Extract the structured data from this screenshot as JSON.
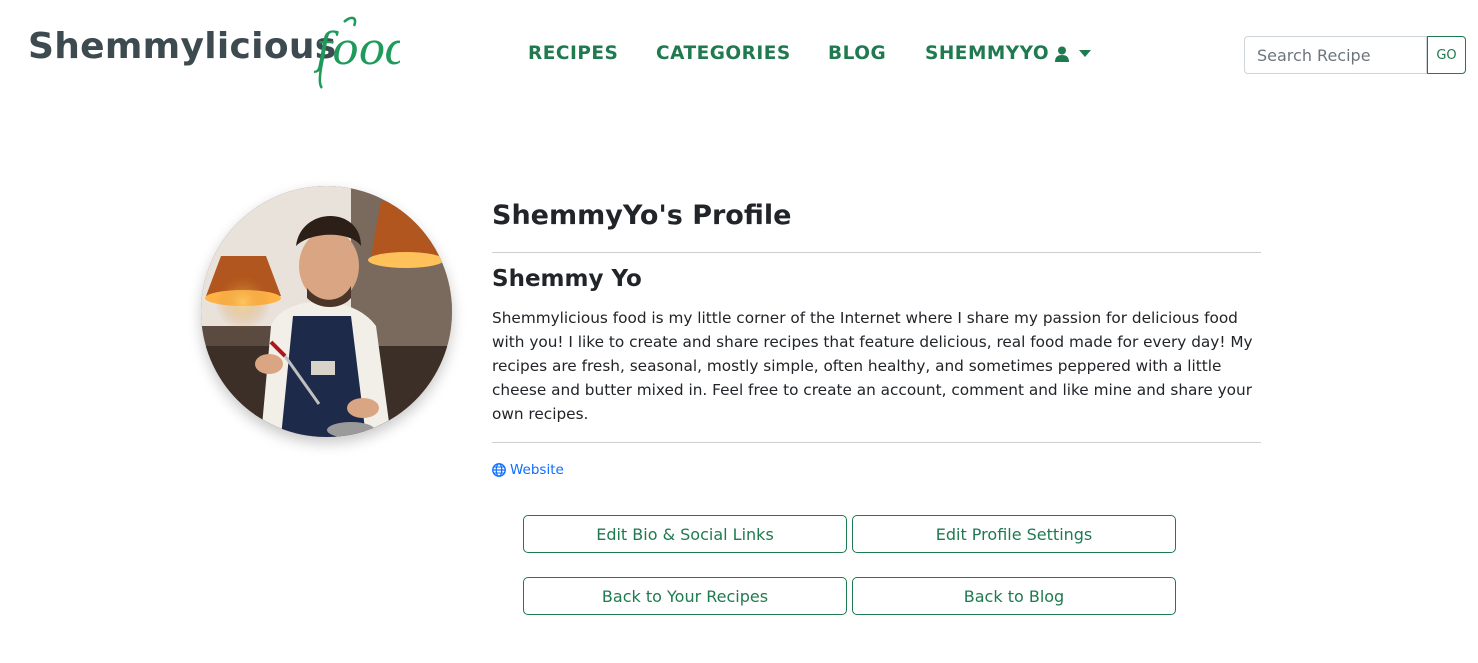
{
  "brand": {
    "name": "Shemmylicious",
    "script": "food",
    "main_color": "#3d4a50",
    "script_color": "#1f9a5a"
  },
  "nav": {
    "recipes": "RECIPES",
    "categories": "CATEGORIES",
    "blog": "BLOG",
    "user": "SHEMMYYO",
    "user_icon": "user-icon",
    "caret_icon": "caret-down-icon",
    "color": "#1f7a4f"
  },
  "search": {
    "placeholder": "Search Recipe",
    "value": "",
    "go_label": "GO"
  },
  "profile": {
    "title": "ShemmyYo's Profile",
    "name": "Shemmy Yo",
    "bio": "Shemmylicious food is my little corner of the Internet where I share my passion for delicious food with you! I like to create and share recipes that feature delicious, real food made for every day! My recipes are fresh, seasonal, mostly simple, often healthy, and sometimes peppered with a little cheese and butter mixed in. Feel free to create an account, comment and like mine and share your own recipes.",
    "website_label": "Website",
    "website_icon": "globe-icon",
    "link_color": "#0d6efd"
  },
  "actions": {
    "edit_bio": "Edit Bio & Social Links",
    "edit_settings": "Edit Profile Settings",
    "back_recipes": "Back to Your Recipes",
    "back_blog": "Back to Blog"
  }
}
